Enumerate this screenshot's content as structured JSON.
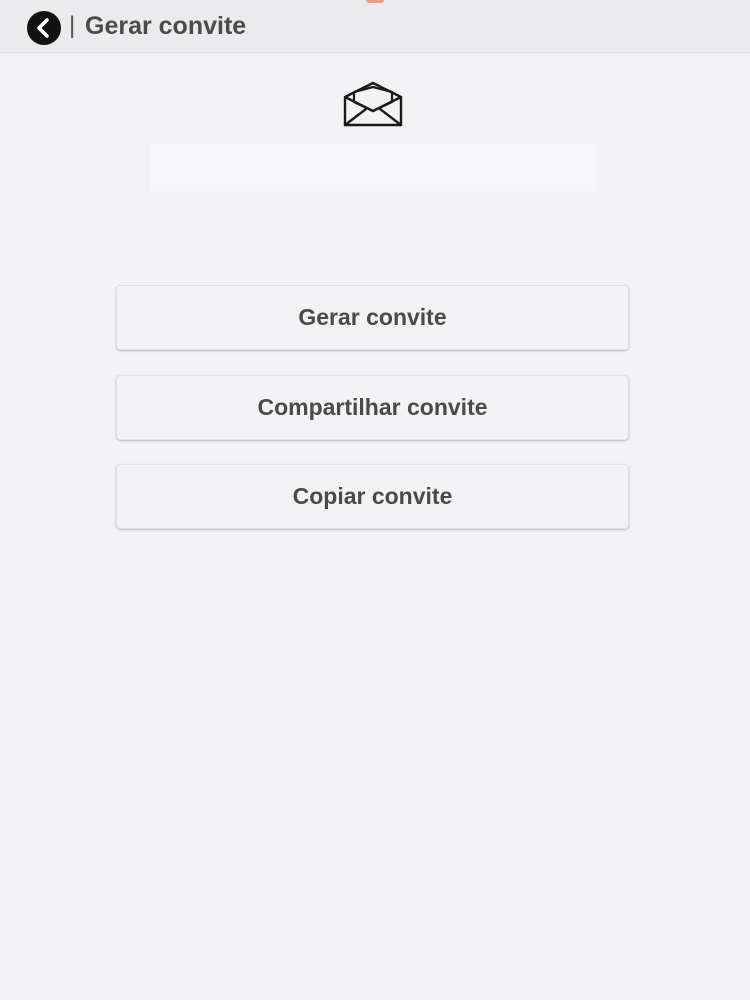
{
  "header": {
    "back_icon": "chevron-left-circle-icon",
    "separator": "|",
    "title": "Gerar convite"
  },
  "main": {
    "envelope_icon": "open-envelope-icon",
    "invite_code": "",
    "buttons": {
      "generate": "Gerar convite",
      "share": "Compartilhar convite",
      "copy": "Copiar convite"
    }
  },
  "colors": {
    "background": "#f3f2f5",
    "header_background": "#ebeaed",
    "button_text": "#4a4a4a",
    "icon": "#111111"
  }
}
